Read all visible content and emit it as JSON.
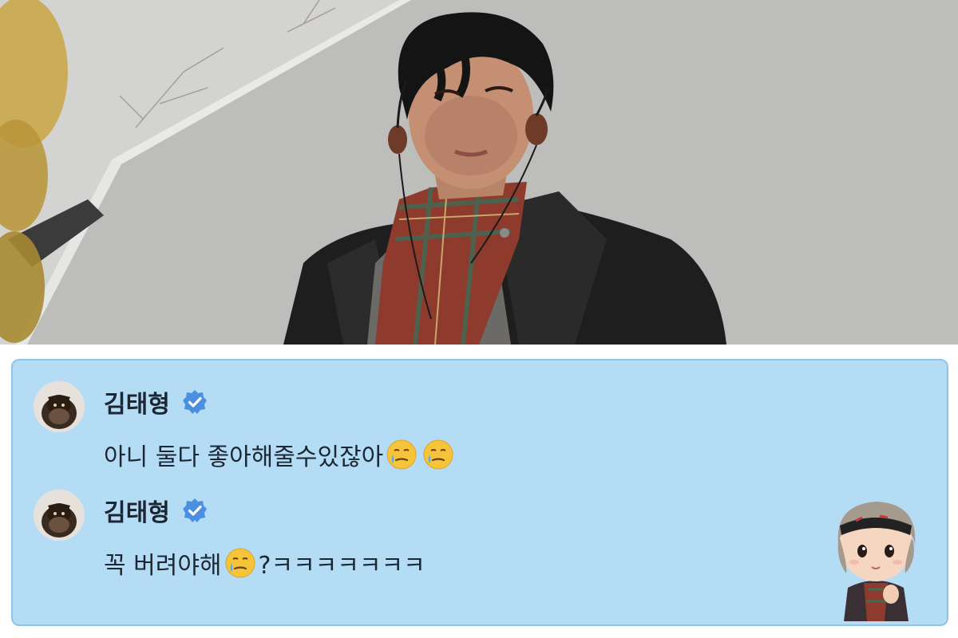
{
  "photo": {
    "subject": "portrait-photo"
  },
  "comments": [
    {
      "username": "김태형",
      "verified": true,
      "text_parts": [
        "아니 둘다 좋아해줄수있잖아"
      ],
      "emoji": "face-holding-back-tears"
    },
    {
      "username": "김태형",
      "verified": true,
      "text_before": "꼭 버려야해",
      "text_after": "?ㅋㅋㅋㅋㅋㅋㅋ",
      "emoji": "face-holding-back-tears"
    }
  ],
  "colors": {
    "card_bg": "#b5dcf5",
    "card_border": "#8fc4e8",
    "verified_badge": "#4a8fe0",
    "text": "#1b2733"
  }
}
